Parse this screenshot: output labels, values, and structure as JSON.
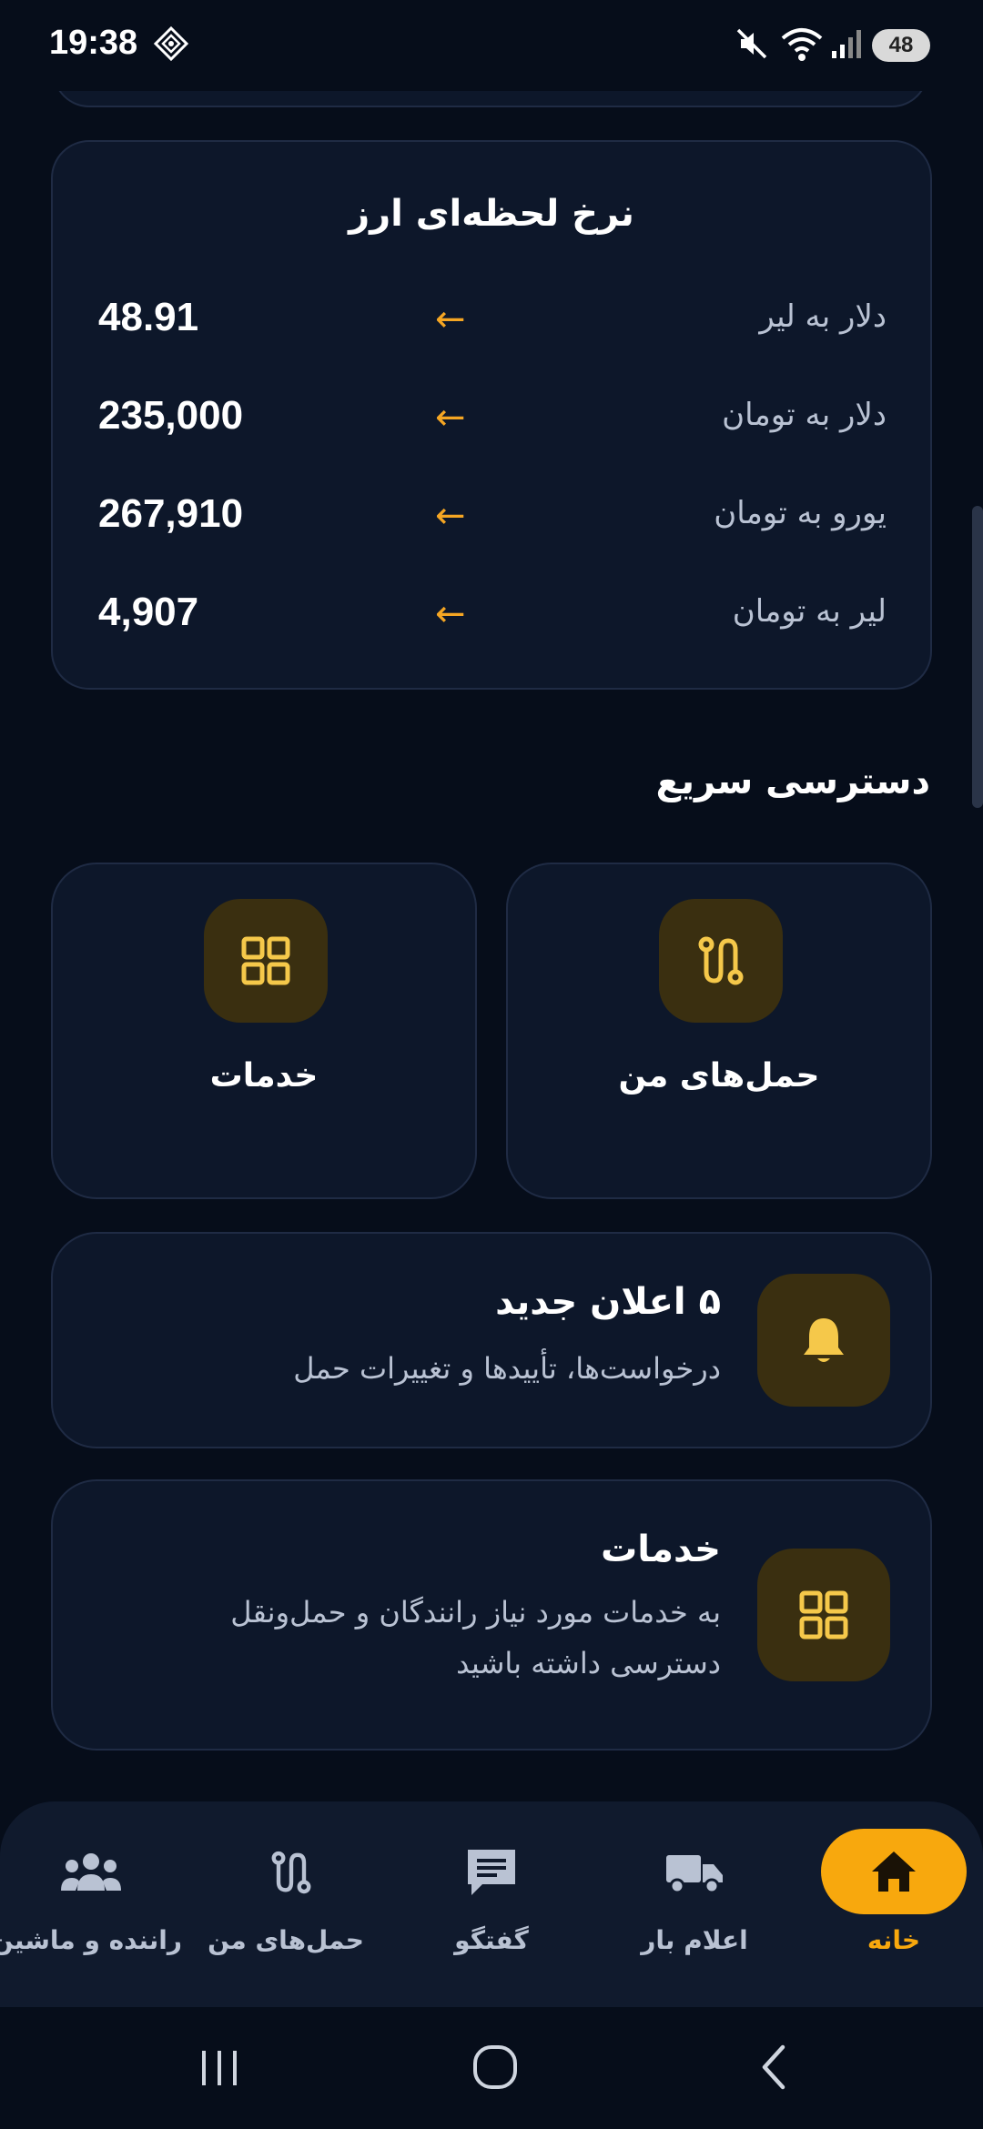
{
  "status_bar": {
    "time": "19:38",
    "battery": "48",
    "icons": [
      "diamond-icon",
      "mute-icon",
      "wifi-icon",
      "signal-icon",
      "battery-icon"
    ]
  },
  "rates": {
    "title": "نرخ لحظه‌ای ارز",
    "arrow": "←",
    "rows": [
      {
        "label": "دلار به لیر",
        "value": "48.91"
      },
      {
        "label": "دلار به تومان",
        "value": "235,000"
      },
      {
        "label": "یورو به تومان",
        "value": "267,910"
      },
      {
        "label": "لیر به تومان",
        "value": "4,907"
      }
    ]
  },
  "quick_access": {
    "title": "دسترسی سریع",
    "tiles": [
      {
        "label": "حمل‌های من",
        "icon": "route-icon"
      },
      {
        "label": "خدمات",
        "icon": "grid-icon"
      }
    ]
  },
  "notifications_card": {
    "title": "۵ اعلان جدید",
    "subtitle": "درخواست‌ها، تأییدها و تغییرات حمل",
    "icon": "bell-icon"
  },
  "services_card": {
    "title": "خدمات",
    "subtitle": "به خدمات مورد نیاز رانندگان و حمل‌ونقل دسترسی داشته باشید",
    "icon": "grid-icon"
  },
  "bottom_nav": {
    "items": [
      {
        "label": "خانه",
        "icon": "home-icon",
        "active": true
      },
      {
        "label": "اعلام بار",
        "icon": "truck-icon",
        "active": false
      },
      {
        "label": "گفتگو",
        "icon": "chat-icon",
        "active": false
      },
      {
        "label": "حمل‌های من",
        "icon": "route-icon",
        "active": false
      },
      {
        "label": "راننده و ماشین",
        "icon": "people-icon",
        "active": false
      }
    ]
  },
  "colors": {
    "background": "#060d1a",
    "card": "#0d172a",
    "accent": "#f8a80d",
    "icon_gold": "#f5c84a"
  }
}
